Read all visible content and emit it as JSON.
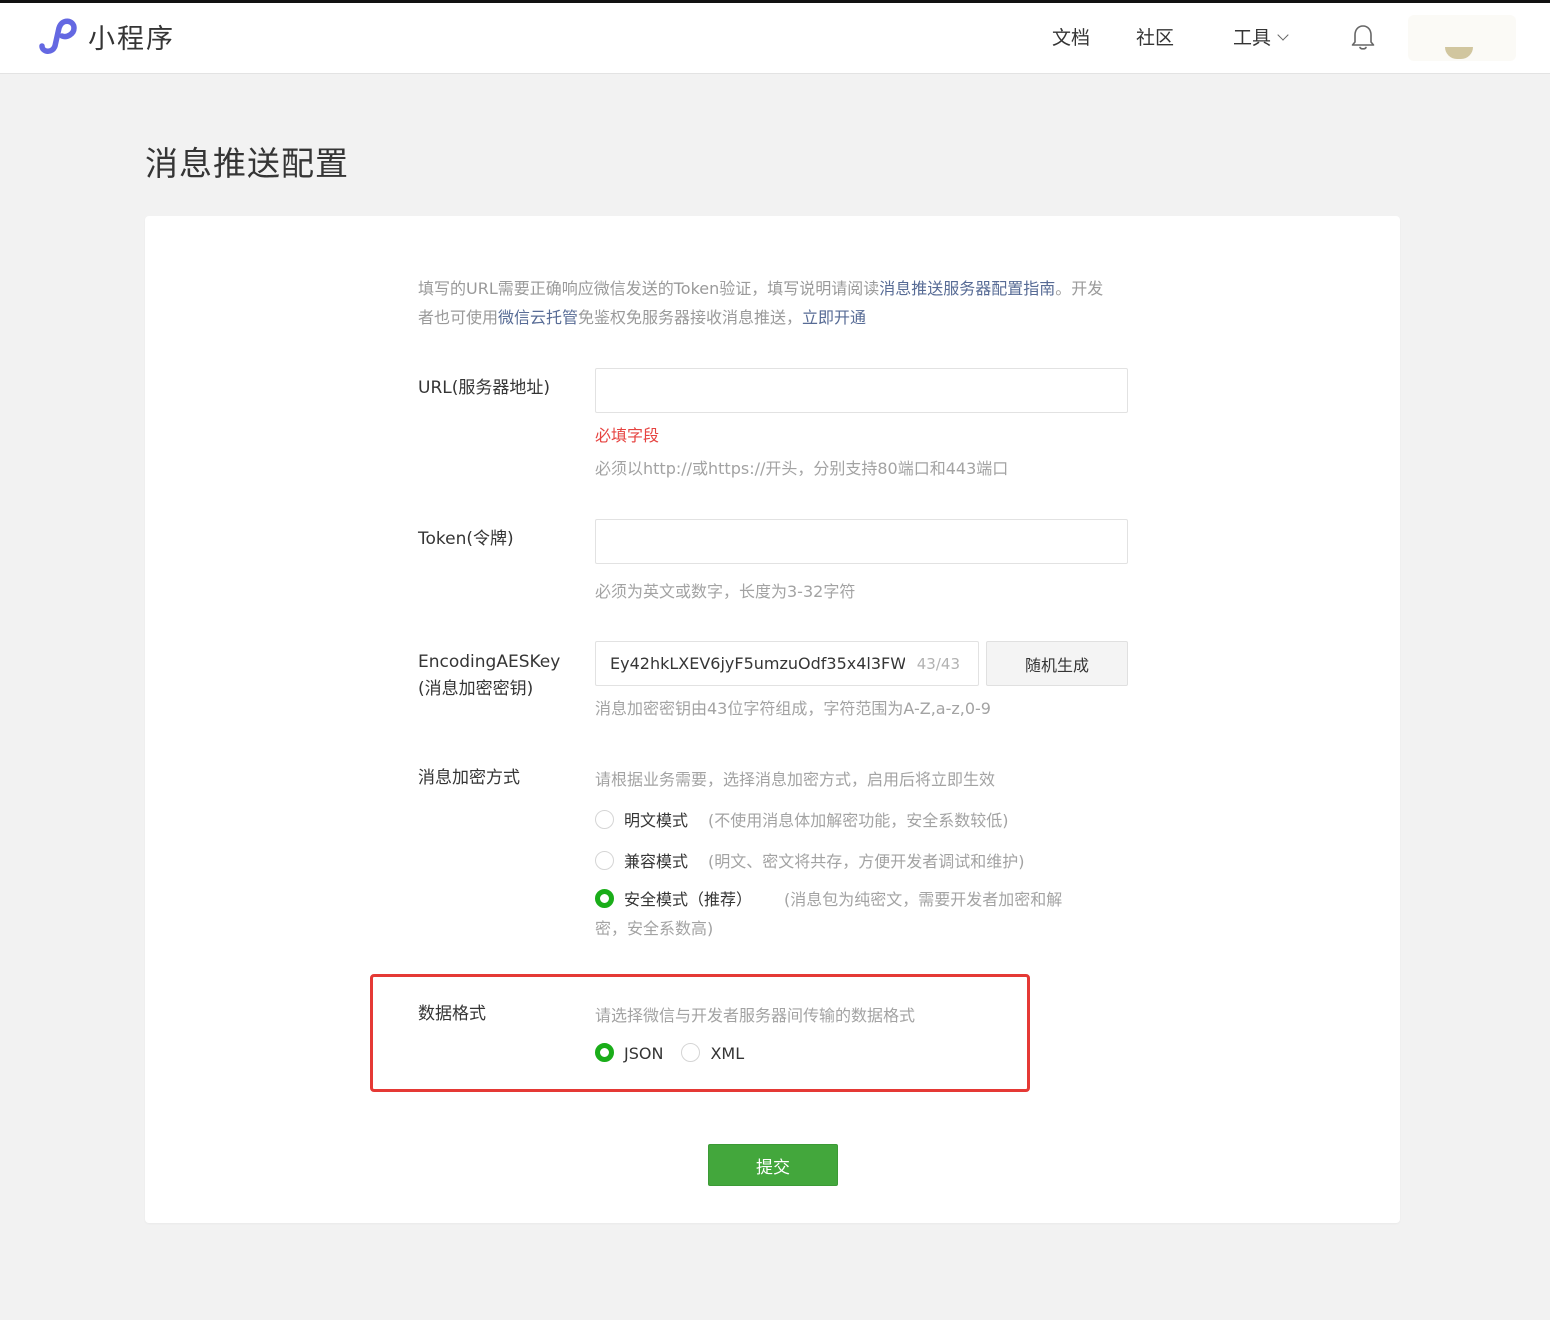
{
  "header": {
    "app_name": "小程序",
    "nav": {
      "docs": "文档",
      "community": "社区",
      "tools": "工具"
    }
  },
  "page": {
    "title": "消息推送配置"
  },
  "intro": {
    "part1": "填写的URL需要正确响应微信发送的Token验证，填写说明请阅读",
    "link1": "消息推送服务器配置指南",
    "part2": "。开发者也可使用",
    "link2": "微信云托管",
    "part3": "免鉴权免服务器接收消息推送，",
    "link3": "立即开通"
  },
  "form": {
    "url": {
      "label": "URL(服务器地址)",
      "value": "",
      "error": "必填字段",
      "hint": "必须以http://或https://开头，分别支持80端口和443端口"
    },
    "token": {
      "label": "Token(令牌)",
      "value": "",
      "hint": "必须为英文或数字，长度为3-32字符"
    },
    "aes": {
      "label_line1": "EncodingAESKey",
      "label_line2": "(消息加密密钥)",
      "value": "Ey42hkLXEV6jyF5umzuOdf35x4l3FW",
      "count": "43/43",
      "generate_button": "随机生成",
      "hint": "消息加密密钥由43位字符组成，字符范围为A-Z,a-z,0-9"
    },
    "encryption": {
      "label": "消息加密方式",
      "hint": "请根据业务需要，选择消息加密方式，启用后将立即生效",
      "options": [
        {
          "label": "明文模式",
          "desc": "(不使用消息体加解密功能，安全系数较低)",
          "selected": false
        },
        {
          "label": "兼容模式",
          "desc": "(明文、密文将共存，方便开发者调试和维护)",
          "selected": false
        },
        {
          "label": "安全模式（推荐）",
          "desc": "(消息包为纯密文，需要开发者加密和解",
          "desc_cont": "密，安全系数高)",
          "selected": true
        }
      ]
    },
    "data_format": {
      "label": "数据格式",
      "hint": "请选择微信与开发者服务器间传输的数据格式",
      "options": [
        {
          "label": "JSON",
          "selected": true
        },
        {
          "label": "XML",
          "selected": false
        }
      ]
    },
    "submit_button": "提交"
  },
  "colors": {
    "accent_green": "#1aad19",
    "submit_green": "#43a73c",
    "link_blue": "#576b95",
    "error_red": "#e64340",
    "highlight_red": "#e53935"
  }
}
